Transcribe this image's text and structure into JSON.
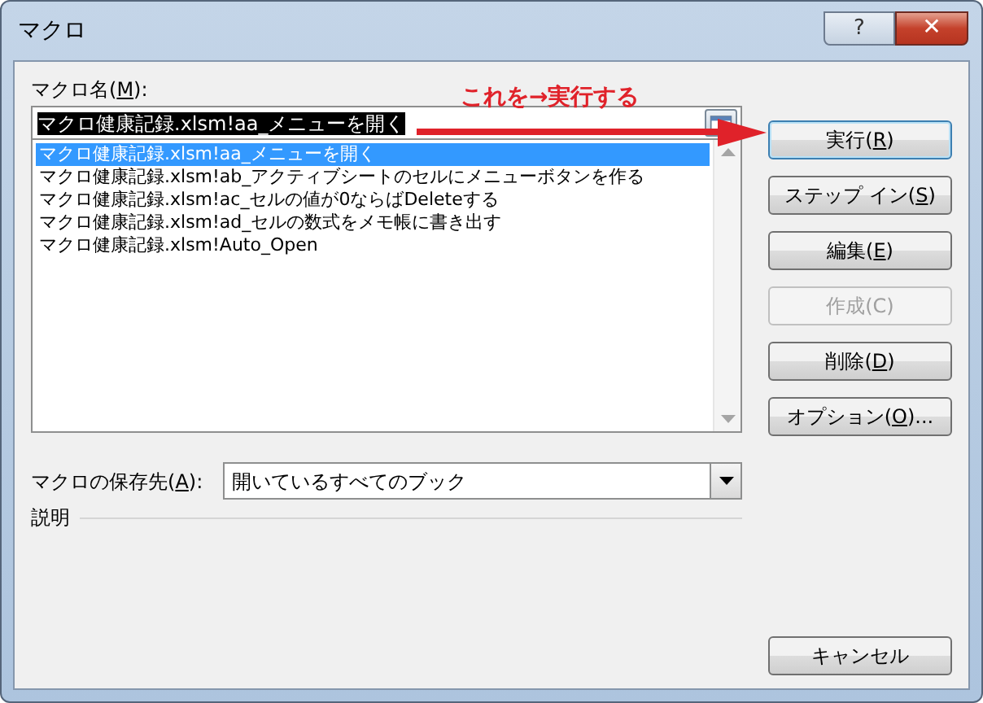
{
  "window": {
    "title": "マクロ",
    "help": "?",
    "close": "✕"
  },
  "macro_name": {
    "label": [
      {
        "t": "マクロ名("
      },
      {
        "t": "M",
        "key": true
      },
      {
        "t": "):"
      }
    ],
    "value": "マクロ健康記録.xlsm!aa_メニューを開く",
    "value_highlighted": true
  },
  "macros": [
    {
      "label": "マクロ健康記録.xlsm!aa_メニューを開く",
      "selected": true
    },
    {
      "label": "マクロ健康記録.xlsm!ab_アクティブシートのセルにメニューボタンを作る",
      "selected": false
    },
    {
      "label": "マクロ健康記録.xlsm!ac_セルの値が0ならばDeleteする",
      "selected": false
    },
    {
      "label": "マクロ健康記録.xlsm!ad_セルの数式をメモ帳に書き出す",
      "selected": false
    },
    {
      "label": "マクロ健康記録.xlsm!Auto_Open",
      "selected": false
    }
  ],
  "buttons": [
    {
      "parts": [
        {
          "t": "実行("
        },
        {
          "t": "R",
          "key": true
        },
        {
          "t": ")"
        }
      ],
      "disabled": false,
      "focused": true
    },
    {
      "parts": [
        {
          "t": "ステップ イン("
        },
        {
          "t": "S",
          "key": true
        },
        {
          "t": ")"
        }
      ],
      "disabled": false,
      "focused": false
    },
    {
      "parts": [
        {
          "t": "編集("
        },
        {
          "t": "E",
          "key": true
        },
        {
          "t": ")"
        }
      ],
      "disabled": false,
      "focused": false
    },
    {
      "parts": [
        {
          "t": "作成(C)"
        }
      ],
      "disabled": true,
      "focused": false
    },
    {
      "parts": [
        {
          "t": "削除("
        },
        {
          "t": "D",
          "key": true
        },
        {
          "t": ")"
        }
      ],
      "disabled": false,
      "focused": false
    },
    {
      "parts": [
        {
          "t": "オプション("
        },
        {
          "t": "O",
          "key": true
        },
        {
          "t": ")..."
        }
      ],
      "disabled": false,
      "focused": false
    }
  ],
  "storage": {
    "label": [
      {
        "t": "マクロの保存先("
      },
      {
        "t": "A",
        "key": true
      },
      {
        "t": "):"
      }
    ],
    "value": "開いているすべてのブック"
  },
  "description": {
    "label": "説明"
  },
  "cancel": {
    "label": "キャンセル"
  },
  "annotation": {
    "text": "これを→実行する"
  }
}
